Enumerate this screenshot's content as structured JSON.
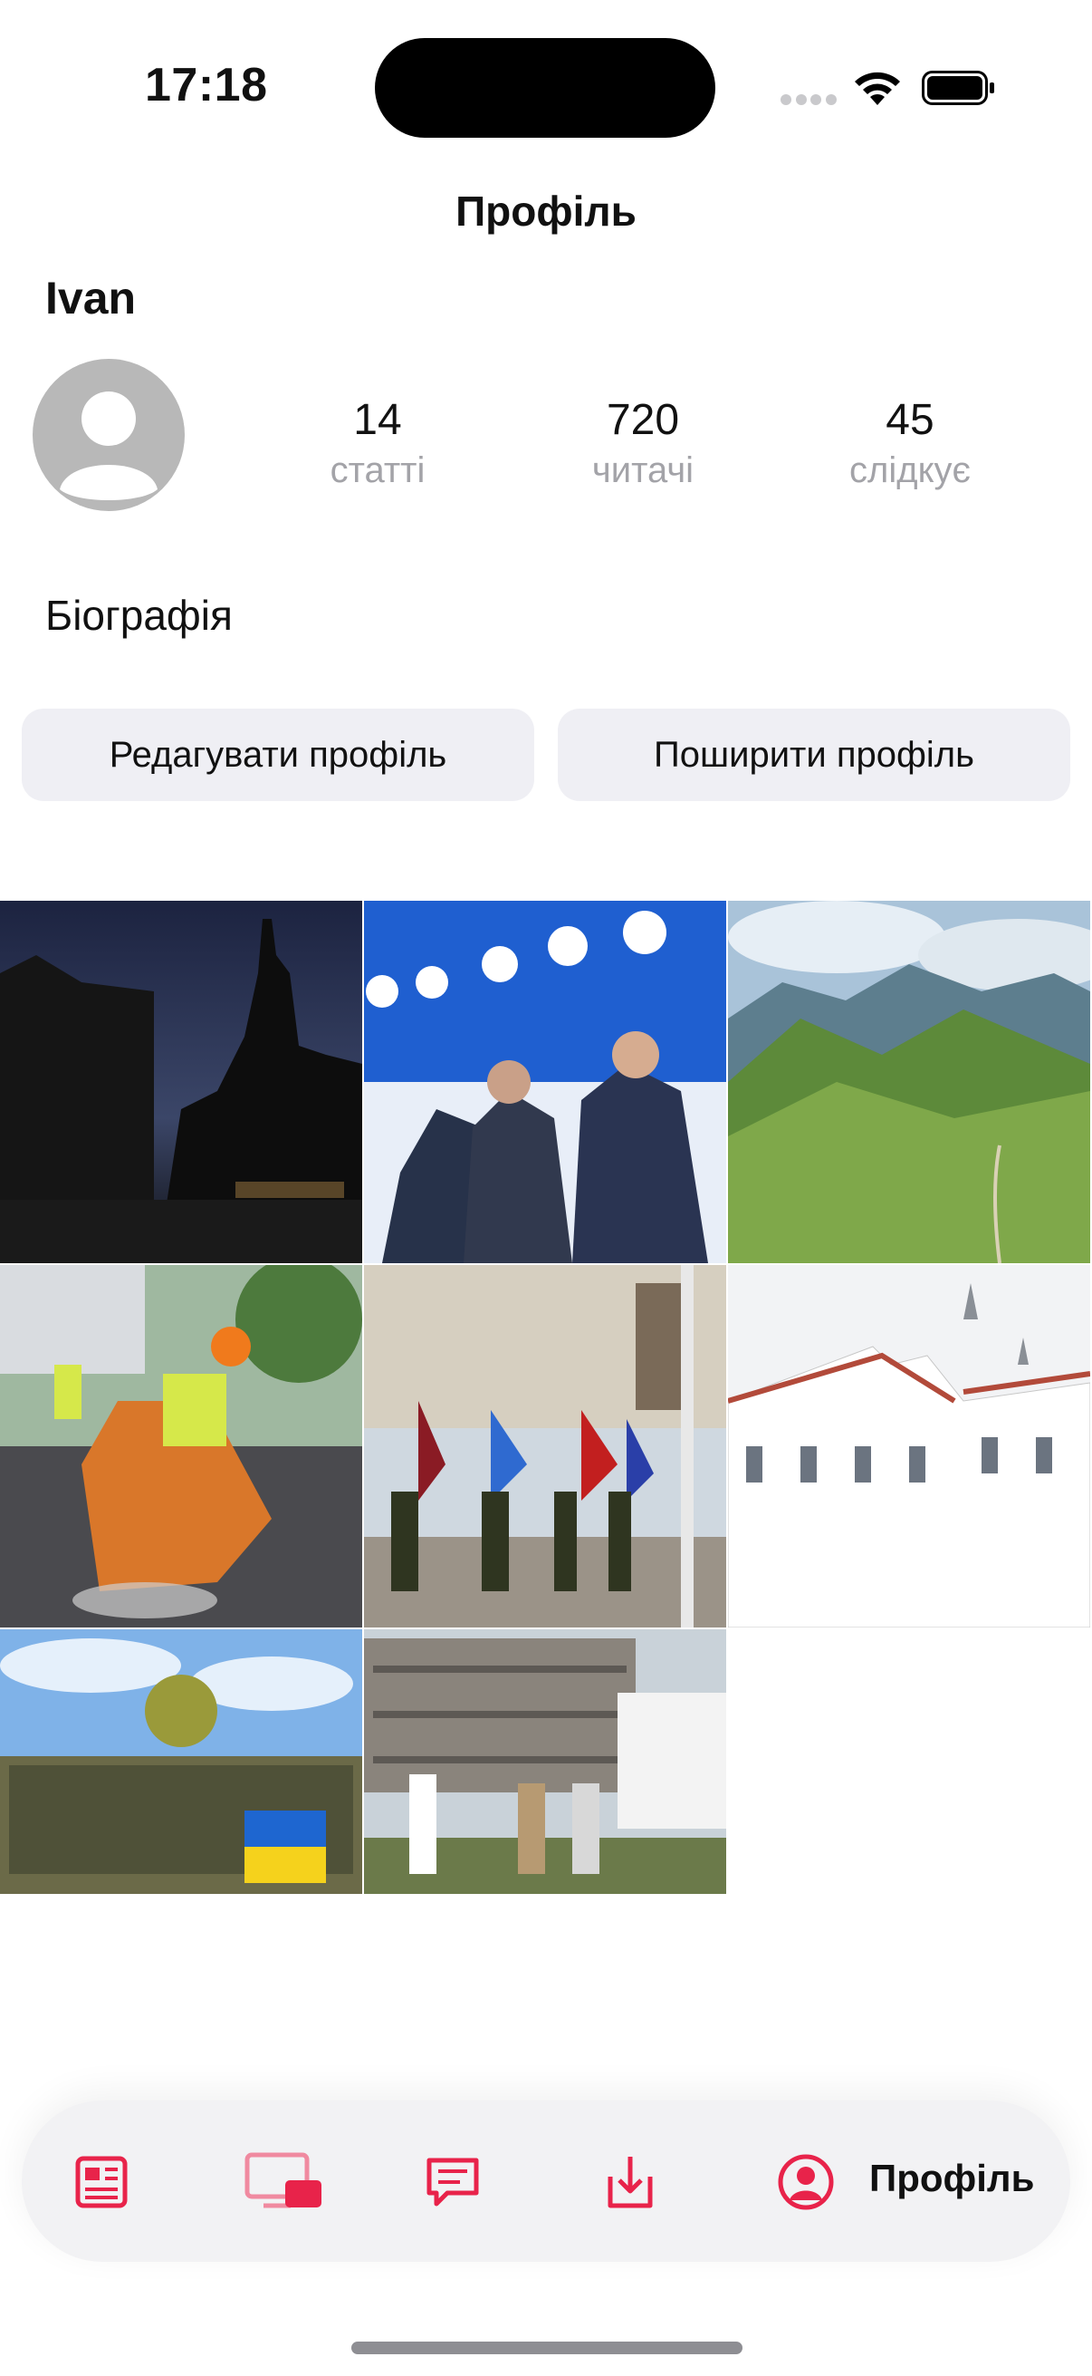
{
  "status_bar": {
    "time": "17:18"
  },
  "header": {
    "title": "Профіль"
  },
  "profile": {
    "username": "Ivan",
    "bio_label": "Біографія",
    "stats": [
      {
        "value": "14",
        "label": "статті"
      },
      {
        "value": "720",
        "label": "читачі"
      },
      {
        "value": "45",
        "label": "слідкує"
      }
    ]
  },
  "actions": {
    "edit_label": "Редагувати профіль",
    "share_label": "Поширити профіль"
  },
  "grid": {
    "photos": [
      {
        "name": "photo-night-city"
      },
      {
        "name": "photo-conference-panel"
      },
      {
        "name": "photo-mountain-valley"
      },
      {
        "name": "photo-road-workers"
      },
      {
        "name": "photo-military-ceremony"
      },
      {
        "name": "photo-white-castle"
      },
      {
        "name": "photo-soldiers-flag"
      },
      {
        "name": "photo-construction-visit"
      }
    ]
  },
  "tabbar": {
    "items": [
      {
        "icon": "newspaper-icon"
      },
      {
        "icon": "devices-icon"
      },
      {
        "icon": "chat-icon"
      },
      {
        "icon": "download-tray-icon"
      },
      {
        "icon": "person-circle-icon",
        "label": "Профіль"
      }
    ],
    "accent_color": "#e8234a",
    "inactive_color": "#f08aa0"
  }
}
